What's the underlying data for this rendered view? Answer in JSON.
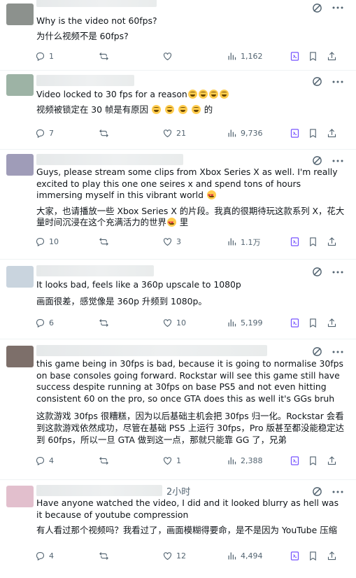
{
  "colors": {
    "text_primary": "#0f1419",
    "text_secondary": "#536471",
    "grok_purple": "#7856ff",
    "divider": "#eff3f4"
  },
  "icons": {
    "grok": "grok-icon",
    "more": "more-icon",
    "reply": "reply-icon",
    "retweet": "retweet-icon",
    "like": "heart-icon",
    "views": "views-icon",
    "bookmark": "bookmark-icon",
    "share": "share-icon"
  },
  "posts": [
    {
      "avatar_color": "#8c918d",
      "time": "",
      "en": "Why is the video not 60fps?",
      "zh": "为什么视频不是 60fps?",
      "stats": {
        "replies": "1",
        "retweets": "",
        "likes": "",
        "views": "1,162"
      }
    },
    {
      "avatar_color": "#9db3a5",
      "time": "",
      "en_before": "Video locked to 30 fps for a reason",
      "en_emojis": 4,
      "zh_before": "视频被锁定在 30 帧是有原因 ",
      "zh_emojis": 4,
      "zh_after": " 的",
      "stats": {
        "replies": "7",
        "retweets": "",
        "likes": "21",
        "views": "9,736"
      }
    },
    {
      "avatar_color": "#9f9cb8",
      "time": "",
      "en": "Guys, please stream some clips from Xbox Series X as well. I'm really excited to play this one one seires x and spend tons of hours immersing myself in this vibrant world",
      "zh_before": "大家，也请播放一些 Xbox Series X 的片段。我真的很期待玩这款系列 X，花大量时间沉浸在这个充满活力的世界",
      "zh_after": " 里",
      "stats": {
        "replies": "10",
        "retweets": "",
        "likes": "3",
        "views": "1.1万"
      }
    },
    {
      "avatar_color": "#c9d4de",
      "time": "",
      "en": "It looks bad, feels like a 360p upscale to 1080p",
      "zh": "画面很差，感觉像是 360p 升频到 1080p。",
      "stats": {
        "replies": "6",
        "retweets": "",
        "likes": "10",
        "views": "5,199"
      }
    },
    {
      "avatar_color": "#7d6f6a",
      "time": "",
      "en": "this game being in 30fps is bad, because it is going to normalise 30fps on base consoles going forward. Rockstar will see this game still have success despite running at 30fps on base PS5 and not even hitting consistent 60 on the pro, so once GTA does this as well it's GGs bruh",
      "zh": "这款游戏 30fps 很糟糕，因为以后基础主机会把 30fps 归一化。Rockstar 会看到这款游戏依然成功，尽管在基础 PS5 上运行 30fps，Pro 版甚至都没能稳定达到 60fps，所以一旦 GTA 做到这一点，那就只能靠 GG 了，兄弟",
      "stats": {
        "replies": "4",
        "retweets": "",
        "likes": "1",
        "views": "2,388"
      }
    },
    {
      "avatar_color": "#e2bfcd",
      "time": "2小时",
      "en": "Have anyone watched the video, I did and it looked blurry as hell was it because of youtube compression",
      "zh": "有人看过那个视频吗？我看过了，画面模糊得要命，是不是因为 YouTube 压缩",
      "stats": {
        "replies": "4",
        "retweets": "",
        "likes": "12",
        "views": "4,494"
      }
    }
  ]
}
